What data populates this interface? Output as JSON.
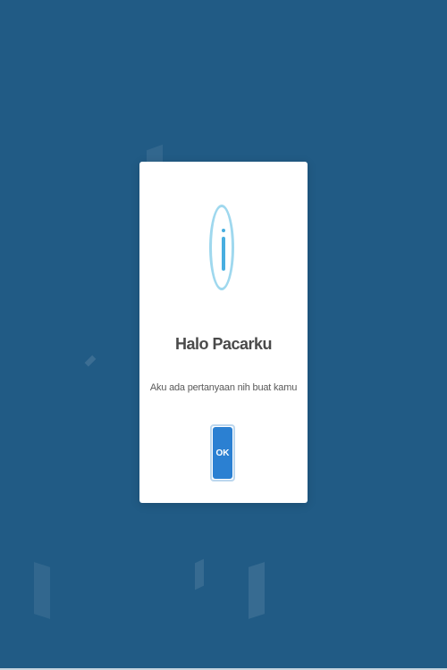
{
  "dialog": {
    "title": "Halo Pacarku",
    "message": "Aku ada pertanyaan nih buat kamu",
    "ok_label": "OK",
    "icon": "info-icon"
  },
  "colors": {
    "background": "#215b85",
    "dialog_background": "#ffffff",
    "accent": "#2b80d2",
    "icon_ring": "#9fd8ee",
    "icon_glyph": "#48aee0"
  }
}
